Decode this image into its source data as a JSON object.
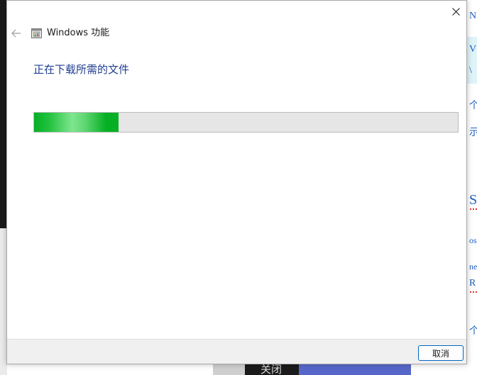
{
  "dialog": {
    "title": "Windows 功能",
    "heading": "正在下载所需的文件",
    "progress_percent": 20,
    "cancel_label": "取消"
  },
  "icons": {
    "close": "close-icon",
    "back": "back-arrow-icon",
    "app": "windows-features-icon"
  },
  "colors": {
    "heading": "#1f3e8f",
    "progress_fill": "#06b025",
    "progress_track": "#e6e6e6",
    "button_border": "#0067c0"
  },
  "background": {
    "right_fragments": [
      "N",
      "V",
      "\\",
      "个",
      "示",
      "S",
      "os",
      "ne",
      "R",
      "个"
    ],
    "bottom_fragment": "关闭"
  }
}
